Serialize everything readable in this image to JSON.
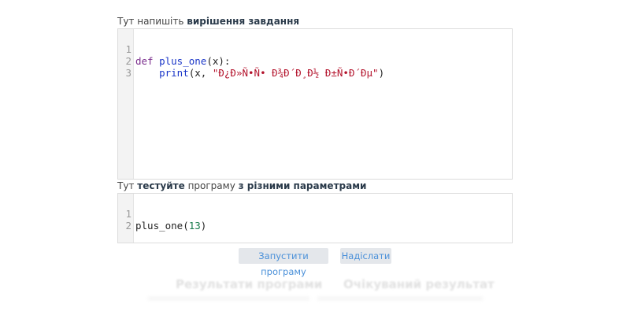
{
  "solution": {
    "label_prefix": "Тут напишіть ",
    "label_bold": "вирішення завдання",
    "lines": [
      {
        "num": "1",
        "kw": "def",
        "fn": "plus_one",
        "rest": "(x):"
      },
      {
        "num": "2",
        "indent": "    ",
        "fn": "print",
        "open": "(x, ",
        "str": "\"Ð¿Ð»Ñ•Ñ• Ð¾Ð´Ð¸Ð½ Ð±Ñ•Ð´Ðµ\"",
        "close": ")"
      },
      {
        "num": "3"
      }
    ]
  },
  "test": {
    "label_prefix": "Тут ",
    "label_bold_1": "тестуйте",
    "label_mid": " програму ",
    "label_bold_2": "з різними параметрами",
    "lines": [
      {
        "num": "1",
        "fn": "plus_one(",
        "arg": "13",
        "close": ")"
      },
      {
        "num": "2"
      }
    ]
  },
  "buttons": {
    "run": "Запустити програму",
    "submit": "Надіслати"
  },
  "results": {
    "program_output": "Результати програми",
    "expected": "Очікуваний результат"
  }
}
